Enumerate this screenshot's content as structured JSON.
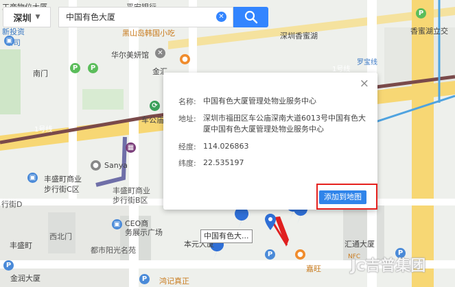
{
  "search": {
    "city": "深圳",
    "query": "中国有色大厦"
  },
  "map_labels": {
    "top_left_1": "工商物位大厦",
    "top_left_2": "新投资",
    "top_left_3": "公司",
    "pingan": "平安银行",
    "heimadao": "黑山岛韩国小吃",
    "shenzhen_xiangmi": "深圳香蜜湖",
    "xiangmi_tower": "香蜜湖立交",
    "nanmen": "南门",
    "huaer": "华尔美妍馆",
    "jinhui": "金汇",
    "metro_line_1": "1号线",
    "metro_line_1_left": "1号线",
    "luobao": "罗宝线",
    "chegongmiao": "车公庙",
    "sanya": "Sanya",
    "fengsheng_1": "丰盛町商业",
    "fengsheng_2": "步行街C区",
    "fengsheng_right_1": "丰盛町商业",
    "fengsheng_right_2": "步行街B区",
    "xingjie_left": "行街D",
    "ceo_1": "CEO商",
    "ceo_2": "务展示广场",
    "xibeimen": "西北门",
    "fengshengding": "丰盛町",
    "dushi": "都市阳光名苑",
    "benyuan": "本元大厦",
    "huitong": "汇通大厦",
    "jinrun": "金润大厦",
    "kongjia": "鸿记真正",
    "jiayi": "嘉旺",
    "nfc": "NFC"
  },
  "info_panel": {
    "name_key": "名称:",
    "name_value": "中国有色大厦管理处物业服务中心",
    "address_key": "地址:",
    "address_value": "深圳市福田区车公庙深南大道6013号中国有色大厦中国有色大厦管理处物业服务中心",
    "lng_key": "经度:",
    "lng_value": "114.026863",
    "lat_key": "纬度:",
    "lat_value": "22.535197",
    "add_button": "添加到地图",
    "close": "×"
  },
  "marker_tag": "中国有色大...",
  "watermark": "Jc吉普集团",
  "colors": {
    "accent": "#3385ff",
    "highlight": "#e5211e",
    "metro_line": "#7a4a4a",
    "road_yellow": "#f7d774",
    "park_green": "#cfe6c8"
  }
}
